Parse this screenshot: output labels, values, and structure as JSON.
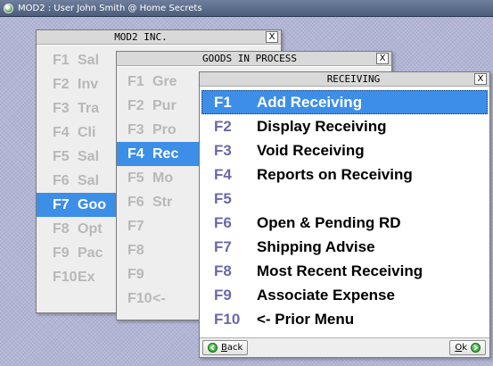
{
  "os_window": {
    "title": "MOD2 : User John Smith @ Home Secrets"
  },
  "windows": {
    "mod2": {
      "title": "MOD2 INC.",
      "close": "X",
      "items": [
        {
          "key": "F1",
          "label": "Sal"
        },
        {
          "key": "F2",
          "label": "Inv"
        },
        {
          "key": "F3",
          "label": "Tra"
        },
        {
          "key": "F4",
          "label": "Cli"
        },
        {
          "key": "F5",
          "label": "Sal"
        },
        {
          "key": "F6",
          "label": "Sal"
        },
        {
          "key": "F7",
          "label": "Goo"
        },
        {
          "key": "F8",
          "label": "Opt"
        },
        {
          "key": "F9",
          "label": "Pac"
        },
        {
          "key": "F10",
          "label": "Ex"
        }
      ]
    },
    "goods": {
      "title": "GOODS IN PROCESS",
      "close": "X",
      "items": [
        {
          "key": "F1",
          "label": "Gre"
        },
        {
          "key": "F2",
          "label": "Pur"
        },
        {
          "key": "F3",
          "label": "Pro"
        },
        {
          "key": "F4",
          "label": "Rec"
        },
        {
          "key": "F5",
          "label": "Mo"
        },
        {
          "key": "F6",
          "label": "Str"
        },
        {
          "key": "F7",
          "label": ""
        },
        {
          "key": "F8",
          "label": ""
        },
        {
          "key": "F9",
          "label": ""
        },
        {
          "key": "F10",
          "label": "<-"
        }
      ]
    },
    "receiving": {
      "title": "RECEIVING",
      "close": "X",
      "items": [
        {
          "key": "F1",
          "label": "Add Receiving"
        },
        {
          "key": "F2",
          "label": "Display Receiving"
        },
        {
          "key": "F3",
          "label": "Void Receiving"
        },
        {
          "key": "F4",
          "label": "Reports on Receiving"
        },
        {
          "key": "F5",
          "label": ""
        },
        {
          "key": "F6",
          "label": "Open & Pending RD"
        },
        {
          "key": "F7",
          "label": "Shipping Advise"
        },
        {
          "key": "F8",
          "label": "Most Recent Receiving"
        },
        {
          "key": "F9",
          "label": "Associate Expense"
        },
        {
          "key": "F10",
          "label": "<- Prior Menu"
        }
      ],
      "footer": {
        "back_hotkey": "B",
        "back_rest": "ack",
        "ok_hotkey": "O",
        "ok_rest": "k"
      }
    }
  },
  "colors": {
    "selection": "#3d8ee6",
    "key_text": "#6b68a8",
    "desktop": "#b9bcd9"
  }
}
